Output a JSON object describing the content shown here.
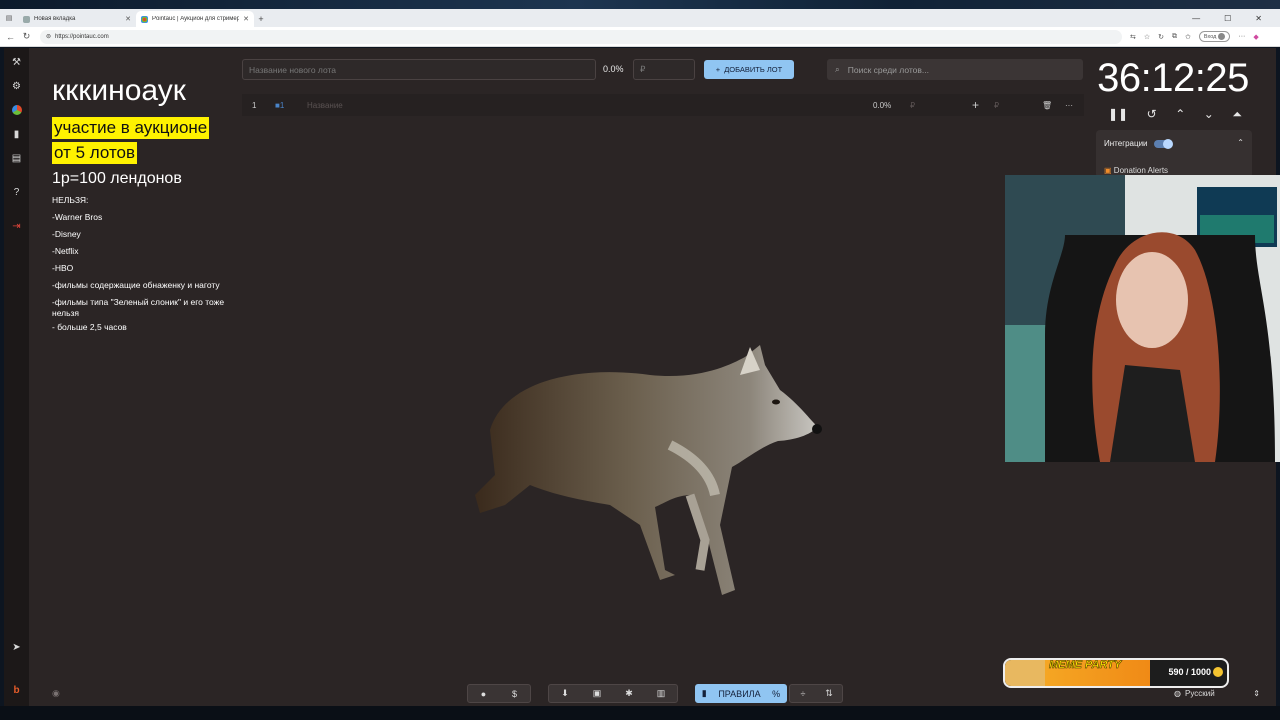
{
  "browser": {
    "tabs": [
      {
        "title": "Новая вкладка",
        "active": false
      },
      {
        "title": "Pointauc | Аукцион для стримера",
        "active": true
      }
    ],
    "url": "https://pointauc.com",
    "login_label": "Вход"
  },
  "notes": {
    "title": "кккиноаук",
    "highlight_line1": "участие в аукционе",
    "highlight_line2": "от 5 лотов",
    "rate": "1р=100 лендонов",
    "forbidden_header": "НЕЛЬЗЯ:",
    "forbidden": [
      "-Warner Bros",
      "-Disney",
      "-Netflix",
      "-HBO",
      "-фильмы содержащие обнаженку и наготу",
      "-фильмы типа \"Зеленый слоник\" и его тоже нельзя",
      "- больше 2,5 часов"
    ]
  },
  "controls": {
    "lot_name_placeholder": "Название нового лота",
    "percent": "0.0%",
    "currency_placeholder": "₽",
    "add_lot_label": "ДОБАВИТЬ ЛОТ",
    "search_placeholder": "Поиск среди лотов..."
  },
  "lot": {
    "index": "1",
    "id": "1",
    "name_placeholder": "Название",
    "percent": "0.0%",
    "currency": "₽"
  },
  "timer": {
    "value": "36:12:25"
  },
  "integrations": {
    "label": "Интеграции",
    "service": "Donation Alerts"
  },
  "footer": {
    "rules_label": "ПРАВИЛА",
    "language": "Русский"
  },
  "meme_party": {
    "label": "MEME PARTY",
    "progress_text": "590 / 1000",
    "progress_fraction": 0.59
  },
  "colors": {
    "background": "#2b2525",
    "accent": "#90c5f2",
    "highlight": "#fff200"
  },
  "icons": [
    "gavel-icon",
    "gear-icon",
    "pie-icon",
    "stats-icon",
    "clipboard-icon",
    "help-icon",
    "logout-icon",
    "telegram-icon",
    "brand-icon",
    "eye-icon"
  ]
}
